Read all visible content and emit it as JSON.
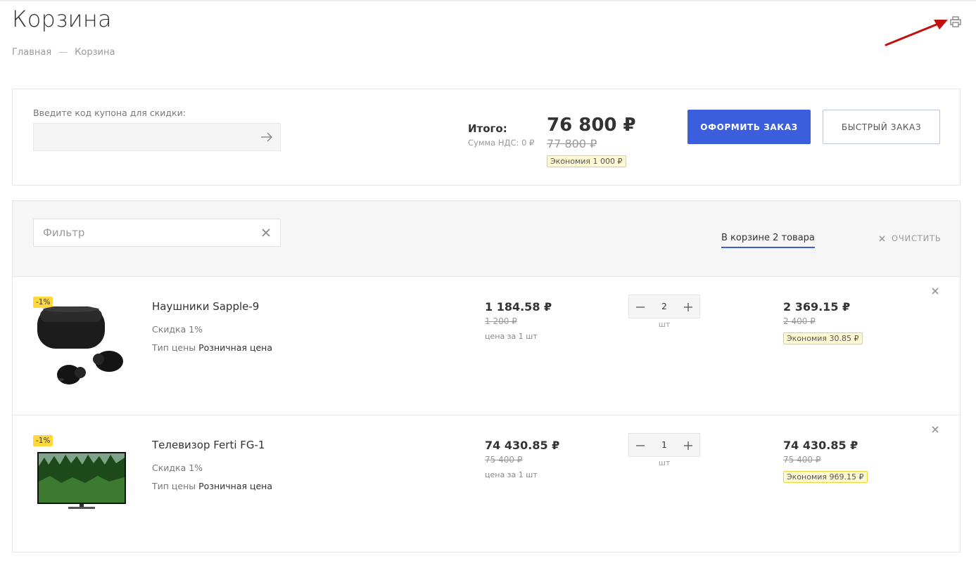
{
  "page": {
    "title": "Корзина",
    "breadcrumb": [
      "Главная",
      "Корзина"
    ],
    "breadcrumb_separator": "—"
  },
  "colors": {
    "accent": "#3a5ede",
    "badge_yellow": "#ffd83c",
    "economy_bg": "#fff9d4",
    "annotation_arrow": "#c40f0f"
  },
  "icons": {
    "print": "print-icon",
    "coupon_submit": "arrow-right-icon",
    "filter_clear": "close-icon",
    "clear_all": "close-icon",
    "remove_item": "close-icon",
    "qty_minus": "minus-icon",
    "qty_plus": "plus-icon"
  },
  "summary": {
    "coupon_label": "Введите код купона для скидки:",
    "coupon_value": "",
    "total_label": "Итого:",
    "vat_text": "Сумма НДС: 0 ₽",
    "total": "76 800 ₽",
    "total_old": "77 800 ₽",
    "economy": "Экономия 1 000 ₽",
    "order_button": "ОФОРМИТЬ ЗАКАЗ",
    "quick_order_button": "БЫСТРЫЙ ЗАКАЗ"
  },
  "cart": {
    "filter_placeholder": "Фильтр",
    "count_label": "В корзине 2 товара",
    "clear_label": "ОЧИСТИТЬ",
    "items": [
      {
        "badge": "-1%",
        "name": "Наушники Sapple-9",
        "discount": "Скидка 1%",
        "price_type_label": "Тип цены",
        "price_type": "Розничная цена",
        "price": "1 184.58 ₽",
        "price_old": "1 200 ₽",
        "price_note": "цена за 1 шт",
        "quantity": "2",
        "unit": "шт",
        "sum": "2 369.15 ₽",
        "sum_old": "2 400 ₽",
        "economy": "Экономия  30.85 ₽"
      },
      {
        "badge": "-1%",
        "name": "Телевизор Ferti FG-1",
        "discount": "Скидка 1%",
        "price_type_label": "Тип цены",
        "price_type": "Розничная цена",
        "price": "74 430.85 ₽",
        "price_old": "75 400 ₽",
        "price_note": "цена за 1 шт",
        "quantity": "1",
        "unit": "шт",
        "sum": "74 430.85 ₽",
        "sum_old": "75 400 ₽",
        "economy": "Экономия  969.15 ₽"
      }
    ]
  }
}
